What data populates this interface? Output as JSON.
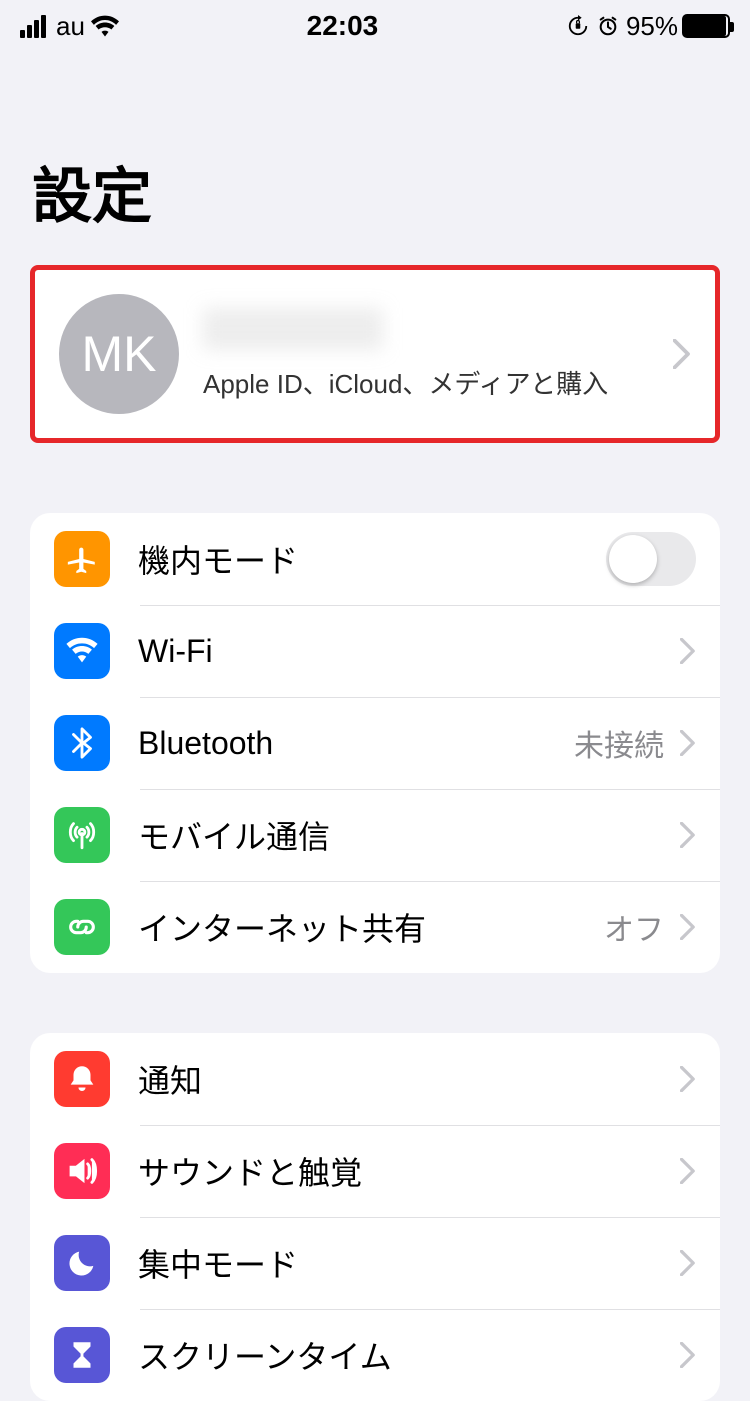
{
  "status": {
    "carrier": "au",
    "time": "22:03",
    "battery_pct": "95%"
  },
  "title": "設定",
  "profile": {
    "initials": "MK",
    "subtitle": "Apple ID、iCloud、メディアと購入"
  },
  "group1": {
    "airplane": "機内モード",
    "wifi": "Wi-Fi",
    "bluetooth": {
      "label": "Bluetooth",
      "value": "未接続"
    },
    "mobile": "モバイル通信",
    "hotspot": {
      "label": "インターネット共有",
      "value": "オフ"
    }
  },
  "group2": {
    "notifications": "通知",
    "sounds": "サウンドと触覚",
    "focus": "集中モード",
    "screentime": "スクリーンタイム"
  }
}
